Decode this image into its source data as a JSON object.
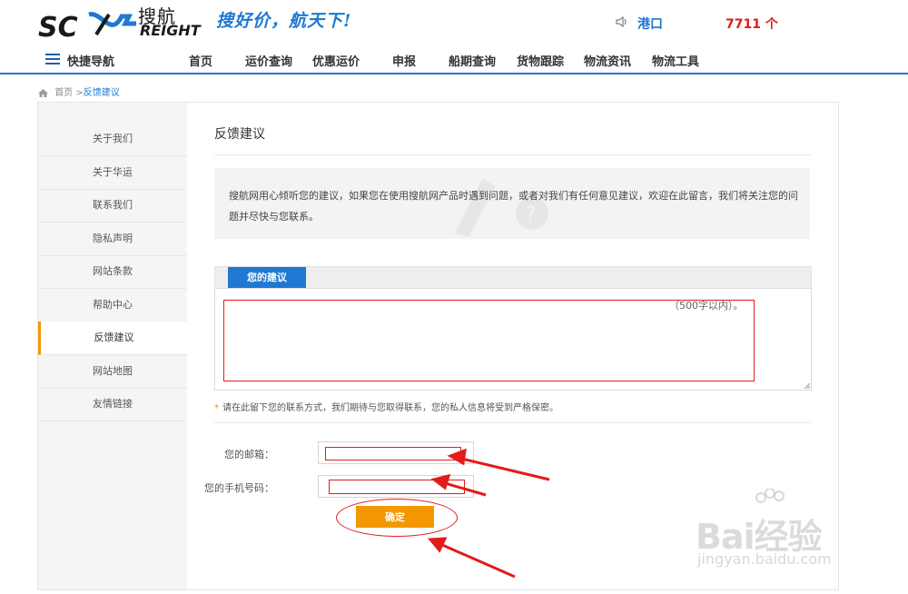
{
  "header": {
    "logo_cn": "搜航",
    "logo_en": "REIGHT",
    "slogan": "搜好价，航天下!",
    "port_label": "港口",
    "count_text": "7711 个"
  },
  "nav": {
    "quick_nav_label": "快捷导航",
    "items": [
      "首页",
      "运价查询",
      "优惠运价",
      "申报",
      "船期查询",
      "货物跟踪",
      "物流资讯",
      "物流工具"
    ]
  },
  "breadcrumb": {
    "home": "首页",
    "separator": ">",
    "current": "反馈建议"
  },
  "sidebar": {
    "items": [
      "关于我们",
      "关于华运",
      "联系我们",
      "隐私声明",
      "网站条款",
      "帮助中心",
      "反馈建议",
      "网站地图",
      "友情链接"
    ],
    "active": "反馈建议"
  },
  "content": {
    "title": "反馈建议",
    "intro": "搜航网用心倾听您的建议，如果您在使用搜航网产品时遇到问题，或者对我们有任何意见建议，欢迎在此留言，我们将关注您的问题并尽快与您联系。",
    "tab_label": "您的建议",
    "textarea_placeholder": "（500字以内）。",
    "note": "请在此留下您的联系方式，我们期待与您取得联系，您的私人信息将受到严格保密。",
    "email_label": "您的邮箱：",
    "phone_label": "您的手机号码：",
    "submit_label": "确定"
  },
  "watermark": {
    "brand": "Bai经验",
    "url": "jingyan.baidu.com"
  },
  "colors": {
    "accent_blue": "#1f78d1",
    "accent_orange": "#f39800",
    "annotation_red": "#e21b1b"
  }
}
